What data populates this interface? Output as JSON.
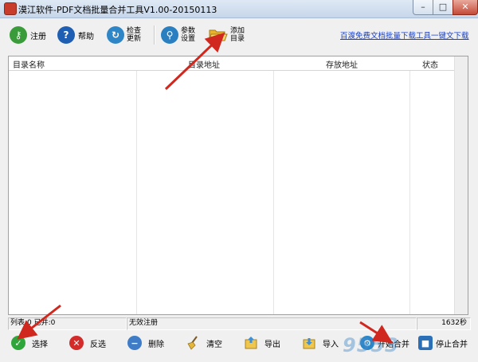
{
  "window": {
    "title": "漠江软件-PDF文档批量合并工具V1.00-20150113",
    "controls": {
      "minimize": "–",
      "maximize": "□",
      "close": "✕"
    }
  },
  "toolbar": {
    "register": "注册",
    "help": "帮助",
    "check_update": "检查更新",
    "settings": "参数设置",
    "add_dir": "添加目录",
    "top_link": "百渡免费文档批量下载工具一键文下载"
  },
  "table": {
    "columns": [
      "目录名称",
      "目录地址",
      "存放地址",
      "状态"
    ]
  },
  "status": {
    "counts": "列表:0 已并:0",
    "license": "无效注册",
    "elapsed": "1632秒"
  },
  "bottom": {
    "select": "选择",
    "invert": "反选",
    "delete": "删除",
    "clear": "清空",
    "export": "导出",
    "import": "导入",
    "start_merge": "开始合并",
    "stop_merge": "停止合并"
  },
  "watermark": "9553",
  "colors": {
    "register_icon": "#3a9b3a",
    "help_icon": "#1f5fb3",
    "update_icon": "#2f86c6",
    "settings_icon": "#2a7fc0",
    "folder_icon": "#e8b52a",
    "select_icon": "#2fa63a",
    "invert_icon": "#d32a2a",
    "arrow_red": "#d0271f"
  },
  "icons": {
    "register": "key-icon",
    "help": "question-icon",
    "update": "refresh-icon",
    "settings": "search-settings-icon",
    "add_dir": "folder-open-icon",
    "select": "check-icon",
    "invert": "x-icon",
    "delete": "remove-icon",
    "clear": "broom-icon",
    "export": "export-icon",
    "import": "import-icon",
    "start": "gear-start-icon",
    "stop": "stop-icon"
  }
}
